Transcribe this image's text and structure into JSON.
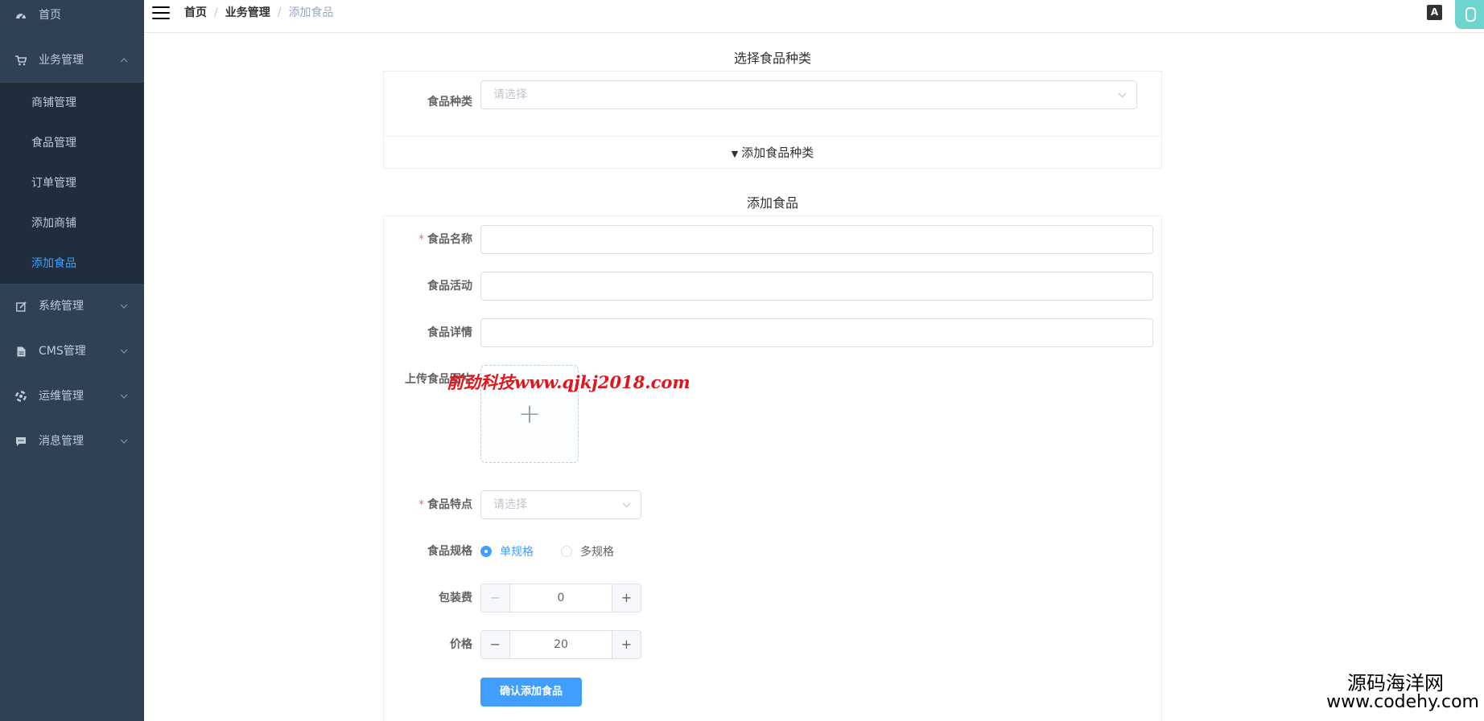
{
  "sidebar": {
    "home": "首页",
    "business": "业务管理",
    "sub_items": [
      "商铺管理",
      "食品管理",
      "订单管理",
      "添加商铺",
      "添加食品"
    ],
    "system": "系统管理",
    "cms": "CMS管理",
    "ops": "运维管理",
    "message": "消息管理"
  },
  "breadcrumb": {
    "items": [
      "首页",
      "业务管理",
      "添加食品"
    ],
    "sep": "/"
  },
  "category_section": {
    "title": "选择食品种类",
    "label": "食品种类",
    "placeholder": "请选择",
    "collapse_label": "添加食品种类"
  },
  "food_section": {
    "title": "添加食品",
    "name_label": "食品名称",
    "activity_label": "食品活动",
    "detail_label": "食品详情",
    "upload_label": "上传食品图片",
    "feature_label": "食品特点",
    "feature_placeholder": "请选择",
    "spec_label": "食品规格",
    "spec_single": "单规格",
    "spec_multi": "多规格",
    "spec_selected": "单规格",
    "packing_fee_label": "包装费",
    "packing_fee_value": "0",
    "price_label": "价格",
    "price_value": "20",
    "submit_label": "确认添加食品"
  },
  "watermarks": {
    "main": "前劲科技www.qjkj2018.com",
    "corner_line1": "源码海洋网",
    "corner_line2": "www.codehy.com"
  },
  "colors": {
    "sidebar_bg": "#304156",
    "submenu_bg": "#1f2d3d",
    "accent": "#409eff",
    "required": "#f56c6c"
  }
}
